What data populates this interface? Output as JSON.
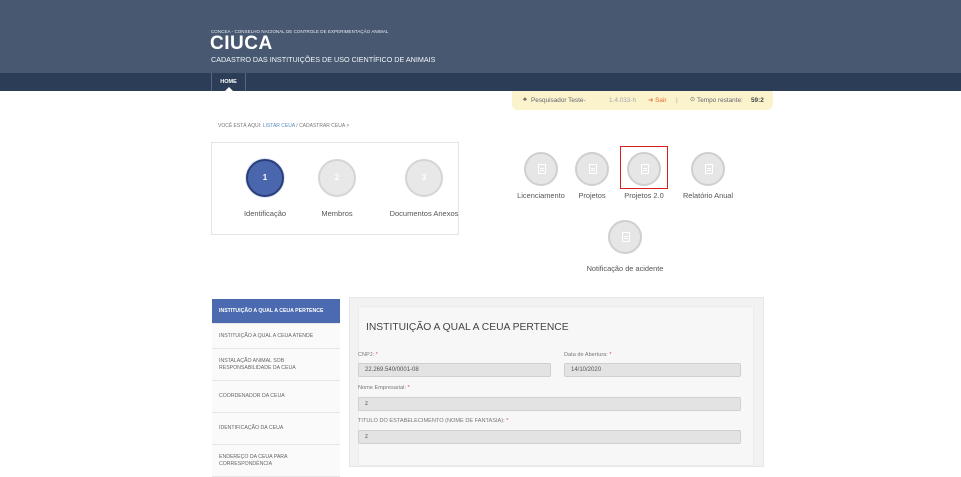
{
  "header": {
    "org_line": "CONCEA - CONSELHO NACIONAL DE CONTROLE DE EXPERIMENTAÇÃO ANIMAL",
    "logo": "CIUCA",
    "subtitle": "CADASTRO DAS INSTITUIÇÕES DE USO CIENTÍFICO DE ANIMAIS"
  },
  "nav": {
    "home": "HOME"
  },
  "userbar": {
    "user_icon": "♣",
    "user_name": "Pesquisador Teste-",
    "version": "1.4.033-h",
    "logout": "➔ Sair",
    "separator": "|",
    "clock_icon": "⊙",
    "time_label": "Tempo restante:",
    "time_value": "59:2"
  },
  "breadcrumb": {
    "prefix": "VOCÊ ESTÁ AQUI:",
    "link1": "LISTAR CEUA",
    "sep": "/",
    "current": "CADASTRAR CEUA >"
  },
  "steps": [
    {
      "number": "1",
      "label": "Identificação"
    },
    {
      "number": "2",
      "label": "Membros"
    },
    {
      "number": "3",
      "label": "Documentos Anexos"
    }
  ],
  "modules": [
    {
      "label": "Licenciamento",
      "icon": "file-icon"
    },
    {
      "label": "Projetos",
      "icon": "document-icon"
    },
    {
      "label": "Projetos 2.0",
      "icon": "document-icon"
    },
    {
      "label": "Relatório Anual",
      "icon": "chart-icon"
    },
    {
      "label": "Notificação de acidente",
      "icon": "document-icon"
    }
  ],
  "sidebar": {
    "items": [
      {
        "label": "INSTITUIÇÃO A QUAL A CEUA PERTENCE"
      },
      {
        "label": "INSTITUIÇÃO A QUAL A CEUA ATENDE"
      },
      {
        "label": "INSTALAÇÃO ANIMAL SOB RESPONSABILIDADE DA CEUA"
      },
      {
        "label": "COORDENADOR DA CEUA"
      },
      {
        "label": "IDENTIFICAÇÃO DA CEUA"
      },
      {
        "label": "ENDEREÇO DA CEUA PARA CORRESPONDÊNCIA"
      }
    ]
  },
  "form": {
    "title": "INSTITUIÇÃO A QUAL A CEUA PERTENCE",
    "required_mark": "*",
    "cnpj_label": "CNPJ:",
    "cnpj_value": "22.269.540/0001-08",
    "opening_label": "Data de Abertura:",
    "opening_value": "14/10/2020",
    "company_label": "Nome Empresarial:",
    "company_value": "z",
    "trade_label": "TITULO DO ESTABELECIMENTO (NOME DE FANTASIA):",
    "trade_value": "z"
  },
  "colors": {
    "header_bg": "#475870",
    "navbar_bg": "#2c3e57",
    "step_active": "#4a67ad",
    "sidebar_active": "#4b6ab0",
    "highlight_border": "#d81e1e"
  }
}
